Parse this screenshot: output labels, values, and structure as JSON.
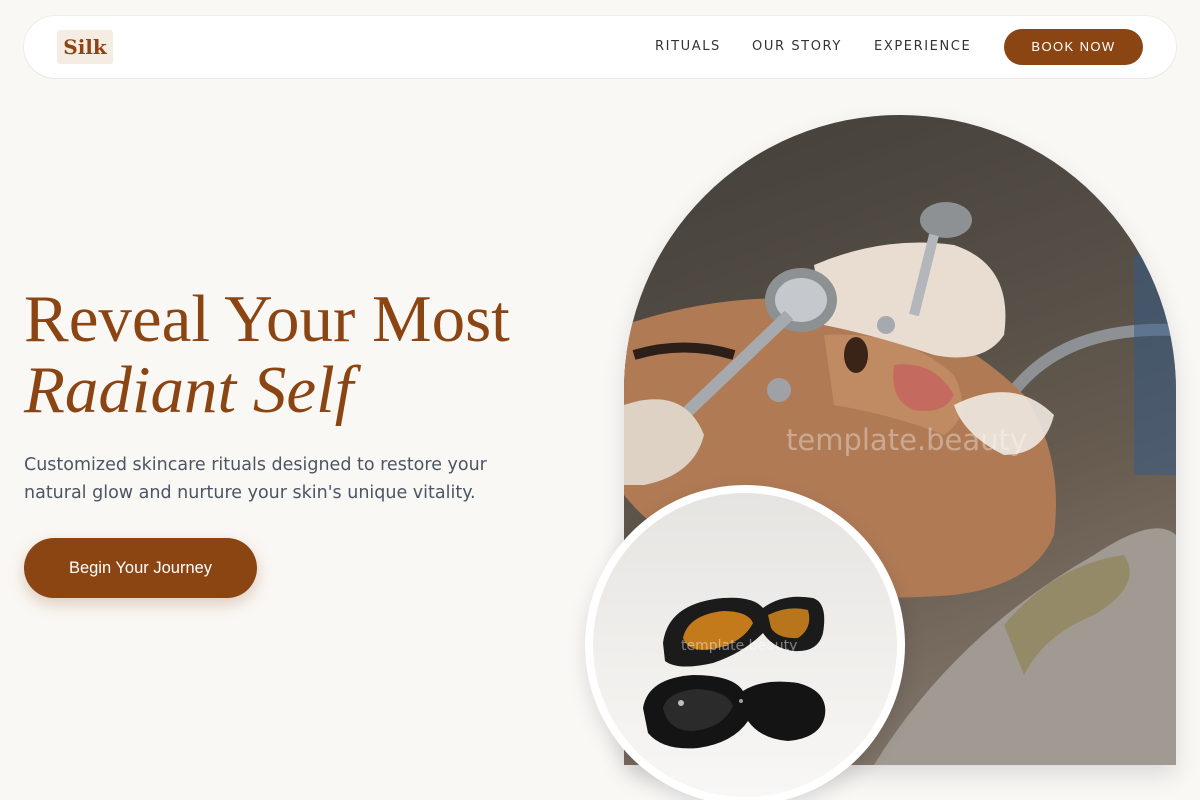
{
  "header": {
    "logo": "Silk",
    "nav_links": [
      "RITUALS",
      "OUR STORY",
      "EXPERIENCE"
    ],
    "cta": "BOOK NOW"
  },
  "hero": {
    "title_line1": "Reveal Your Most",
    "title_line2": "Radiant Self",
    "subtitle_line1": "Customized skincare rituals designed to restore your",
    "subtitle_line2": "natural glow and nurture your skin's unique vitality.",
    "cta": "Begin Your Journey"
  },
  "images": {
    "main_watermark": "template.beauty",
    "secondary_watermark": "template.beauty"
  },
  "colors": {
    "accent": "#8b4513",
    "background": "#faf8f5",
    "text": "#4b5563"
  },
  "icons": [
    "facial-treatment-photo",
    "protective-glasses-photo"
  ]
}
